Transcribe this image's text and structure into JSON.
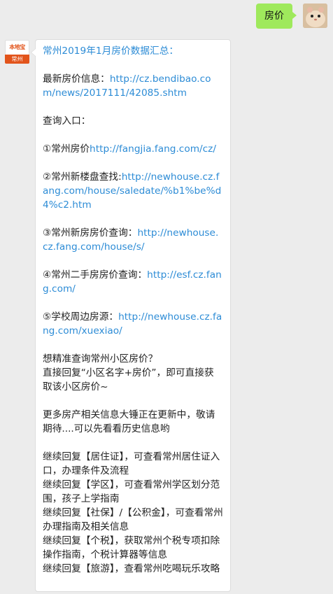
{
  "user_message": {
    "text": "房价"
  },
  "bot_avatar": {
    "brand": "本地宝",
    "city": "常州"
  },
  "message": {
    "title": "常州2019年1月房价数据汇总：",
    "latest_label": "最新房价信息：",
    "latest_url": "http://cz.bendibao.com/news/2017111/42085.shtm",
    "entry_label": "查询入口：",
    "links": [
      {
        "label": "①常州房价",
        "url": "http://fangjia.fang.com/cz/"
      },
      {
        "label": "②常州新楼盘查找:",
        "url": "http://newhouse.cz.fang.com/house/saledate/%b1%be%d4%c2.htm"
      },
      {
        "label": "③常州新房房价查询：",
        "url": "http://newhouse.cz.fang.com/house/s/"
      },
      {
        "label": "④常州二手房房价查询：",
        "url": "http://esf.cz.fang.com/"
      },
      {
        "label": "⑤学校周边房源：",
        "url": "http://newhouse.cz.fang.com/xuexiao/"
      }
    ],
    "prompt_q": "想精准查询常州小区房价？",
    "prompt_a": "直接回复“小区名字+房价”，即可直接获取该小区房价~",
    "more_info": "更多房产相关信息大锤正在更新中，敬请期待....可以先看看历史信息哟",
    "replies": [
      "继续回复【居住证】，可查看常州居住证入口，办理条件及流程",
      "继续回复【学区】，可查看常州学区划分范围，孩子上学指南",
      "继续回复【社保】/【公积金】，可查看常州办理指南及相关信息",
      "继续回复【个税】，获取常州个税专项扣除操作指南，个税计算器等信息",
      "继续回复【旅游】，查看常州吃喝玩乐攻略"
    ]
  }
}
